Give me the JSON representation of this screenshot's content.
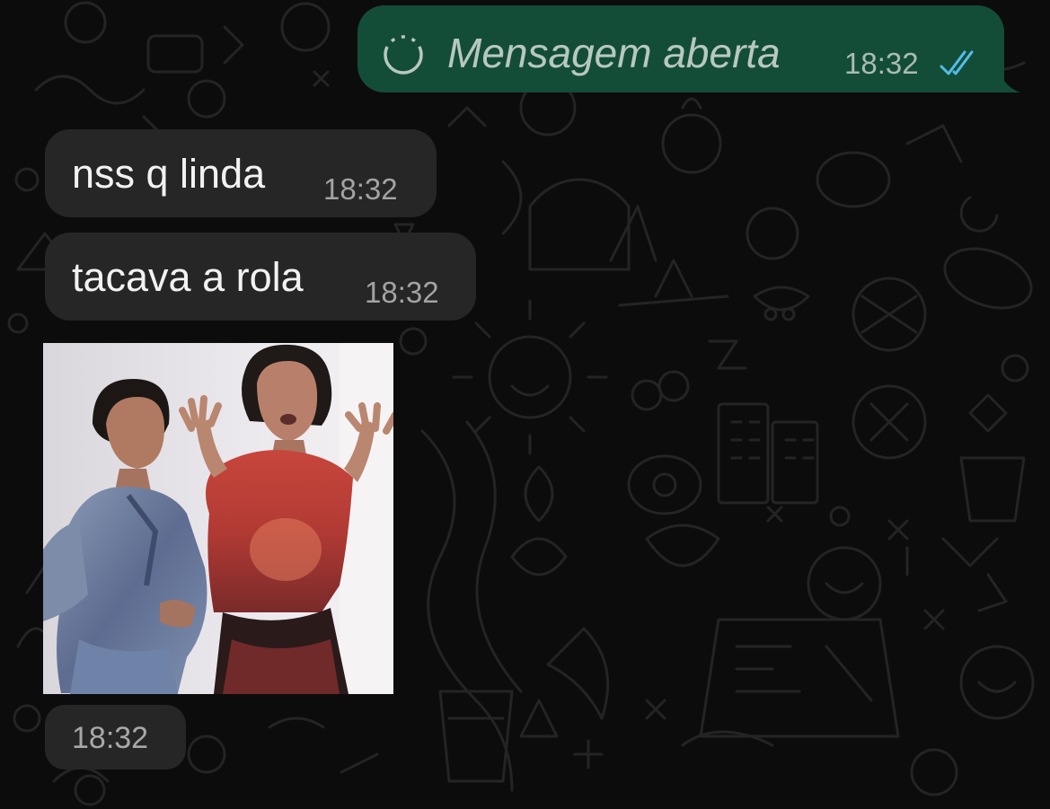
{
  "messages": {
    "outgoing": {
      "text": "Mensagem aberta",
      "time": "18:32",
      "status_icon": "double-check-icon",
      "status_color": "#53bdeb"
    },
    "incoming": [
      {
        "text": "nss q linda",
        "time": "18:32"
      },
      {
        "text": "tacava a rola",
        "time": "18:32"
      }
    ],
    "sticker": {
      "time": "18:32"
    }
  },
  "colors": {
    "outgoing_bubble": "#144d37",
    "incoming_bubble": "#262626",
    "background": "#0c0c0c"
  }
}
